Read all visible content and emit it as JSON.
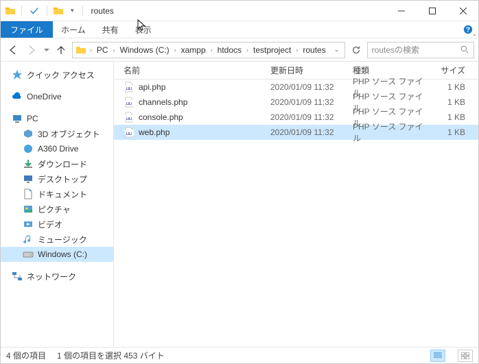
{
  "window": {
    "title": "routes"
  },
  "ribbon": {
    "file": "ファイル",
    "home": "ホーム",
    "share": "共有",
    "view": "表示"
  },
  "breadcrumb": [
    "PC",
    "Windows (C:)",
    "xampp",
    "htdocs",
    "testproject",
    "routes"
  ],
  "search": {
    "placeholder": "routesの検索"
  },
  "sidebar": {
    "quick_access": "クイック アクセス",
    "onedrive": "OneDrive",
    "pc": "PC",
    "pc_children": [
      "3D オブジェクト",
      "A360 Drive",
      "ダウンロード",
      "デスクトップ",
      "ドキュメント",
      "ピクチャ",
      "ビデオ",
      "ミュージック",
      "Windows (C:)"
    ],
    "network": "ネットワーク"
  },
  "columns": {
    "name": "名前",
    "date": "更新日時",
    "type": "種類",
    "size": "サイズ"
  },
  "files": [
    {
      "name": "api.php",
      "date": "2020/01/09 11:32",
      "type": "PHP ソース ファイル",
      "size": "1 KB",
      "selected": false
    },
    {
      "name": "channels.php",
      "date": "2020/01/09 11:32",
      "type": "PHP ソース ファイル",
      "size": "1 KB",
      "selected": false
    },
    {
      "name": "console.php",
      "date": "2020/01/09 11:32",
      "type": "PHP ソース ファイル",
      "size": "1 KB",
      "selected": false
    },
    {
      "name": "web.php",
      "date": "2020/01/09 11:32",
      "type": "PHP ソース ファイル",
      "size": "1 KB",
      "selected": true
    }
  ],
  "status": {
    "count": "4 個の項目",
    "selection": "1 個の項目を選択 453 バイト"
  }
}
